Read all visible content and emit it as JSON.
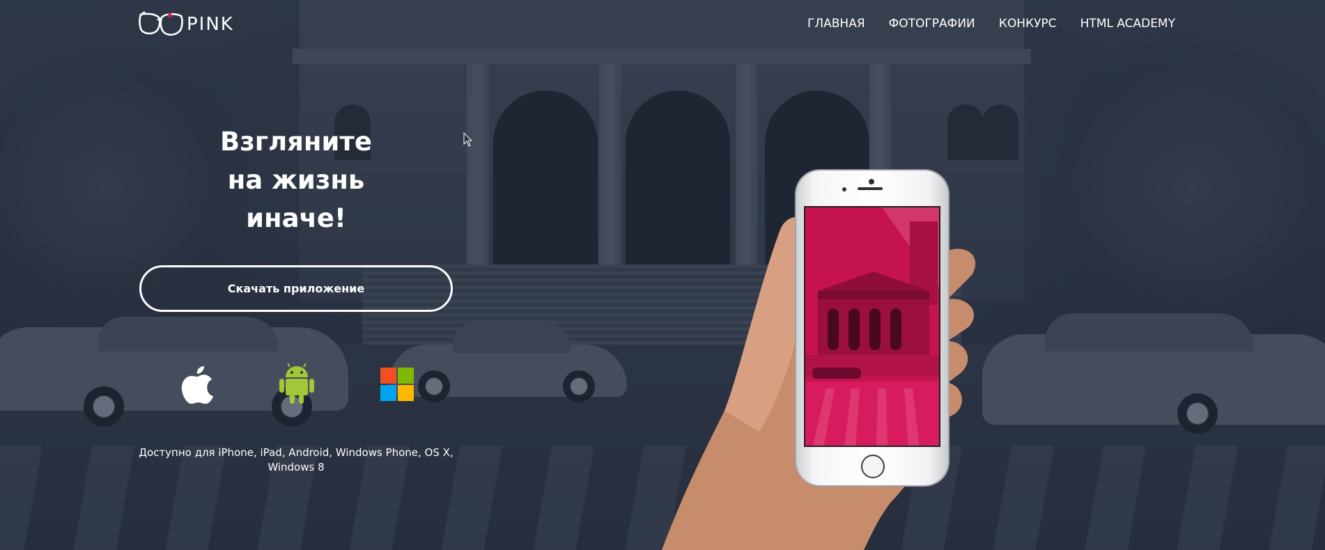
{
  "header": {
    "logo_text": "PINK",
    "nav": [
      {
        "label": "ГЛАВНАЯ"
      },
      {
        "label": "ФОТОГРАФИИ"
      },
      {
        "label": "КОНКУРС"
      },
      {
        "label": "HTML ACADEMY"
      }
    ]
  },
  "hero": {
    "headline_lines": [
      "Взгляните",
      "на жизнь",
      "иначе!"
    ],
    "download_button": "Скачать приложение",
    "platform_icons": [
      "apple-icon",
      "android-icon",
      "windows-icon"
    ],
    "available_text": "Доступно для iPhone, iPad, Android, Windows Phone, OS X, Windows 8"
  },
  "colors": {
    "accent": "#e5185e",
    "screen_pink": "#c4134f",
    "android_green": "#a4c639",
    "windows_red": "#f25022",
    "windows_green": "#7fba00",
    "windows_blue": "#00a4ef",
    "windows_yellow": "#ffb900"
  }
}
